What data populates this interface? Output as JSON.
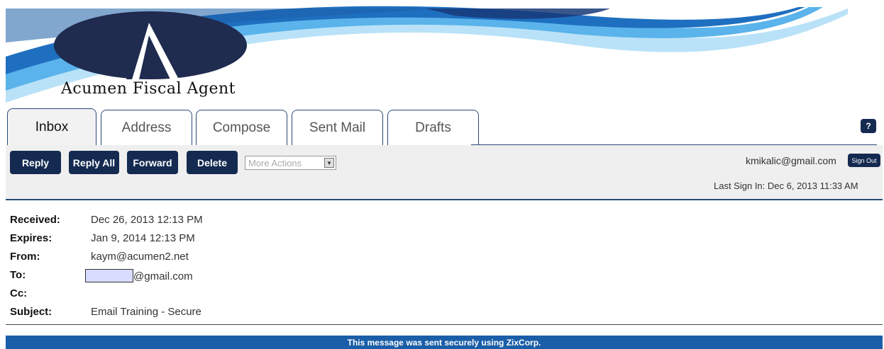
{
  "header": {
    "brand_name": "Acumen Fiscal Agent"
  },
  "tabs": [
    {
      "label": "Inbox",
      "active": true
    },
    {
      "label": "Address",
      "active": false
    },
    {
      "label": "Compose",
      "active": false
    },
    {
      "label": "Sent Mail",
      "active": false
    },
    {
      "label": "Drafts",
      "active": false
    }
  ],
  "help": {
    "label": "?"
  },
  "toolbar": {
    "reply_label": "Reply",
    "reply_all_label": "Reply All",
    "forward_label": "Forward",
    "delete_label": "Delete",
    "more_actions_label": "More Actions"
  },
  "account": {
    "email": "kmikalic@gmail.com",
    "sign_out_label": "Sign Out",
    "last_sign_in": "Last Sign In: Dec 6, 2013 11:33 AM"
  },
  "message": {
    "fields": [
      {
        "label": "Received:",
        "value": "Dec 26, 2013 12:13 PM"
      },
      {
        "label": "Expires:",
        "value": "Jan 9, 2014 12:13 PM"
      },
      {
        "label": "From:",
        "value": "kaym@acumen2.net"
      },
      {
        "label": "To:",
        "value": "@gmail.com"
      },
      {
        "label": "Cc:",
        "value": ""
      },
      {
        "label": "Subject:",
        "value": "Email Training - Secure"
      }
    ]
  },
  "footer": {
    "text": "This message was sent securely using ZixCorp."
  },
  "colors": {
    "navy": "#142a50",
    "footer_blue": "#1a5ea8",
    "wave_light": "#8ccbf0",
    "wave_mid": "#2a8fd8"
  }
}
